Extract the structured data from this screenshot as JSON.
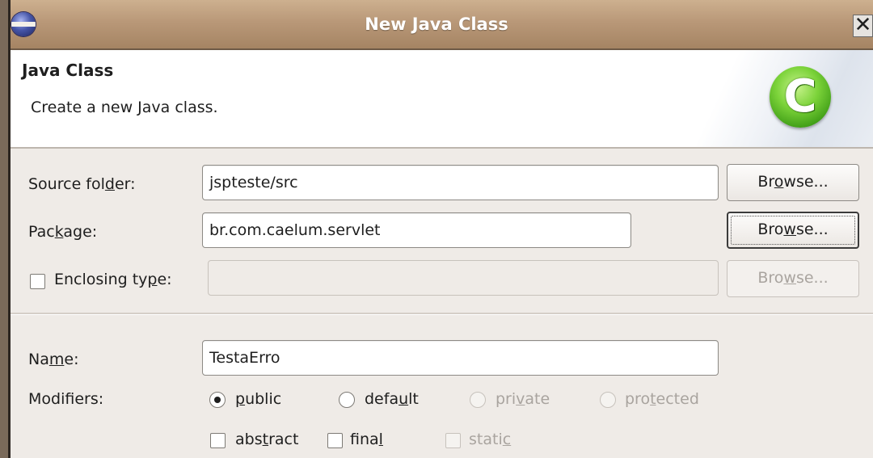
{
  "window": {
    "title": "New Java Class",
    "close_glyph": "✕"
  },
  "header": {
    "title": "Java Class",
    "description": "Create a new Java class.",
    "icon_letter": "C"
  },
  "form": {
    "source_folder": {
      "label_pre": "Source fol",
      "label_mnemonic": "d",
      "label_post": "er:",
      "value": "jspteste/src",
      "browse_pre": "Br",
      "browse_mnemonic": "o",
      "browse_post": "wse..."
    },
    "package": {
      "label_pre": "Pac",
      "label_mnemonic": "k",
      "label_post": "age:",
      "value": "br.com.caelum.servlet",
      "browse_pre": "Bro",
      "browse_mnemonic": "w",
      "browse_post": "se..."
    },
    "enclosing_type": {
      "label_pre": "Enclosing ty",
      "label_mnemonic": "p",
      "label_post": "e:",
      "checked": false,
      "value": "",
      "browse_pre": "Bro",
      "browse_mnemonic": "w",
      "browse_post": "se..."
    },
    "name": {
      "label_pre": "Na",
      "label_mnemonic": "m",
      "label_post": "e:",
      "value": "TestaErro"
    },
    "modifiers": {
      "label": "Modifiers:",
      "options": [
        {
          "pre": "",
          "mnemonic": "p",
          "post": "ublic",
          "selected": true,
          "enabled": true
        },
        {
          "pre": "defa",
          "mnemonic": "u",
          "post": "lt",
          "selected": false,
          "enabled": true
        },
        {
          "pre": "pri",
          "mnemonic": "v",
          "post": "ate",
          "selected": false,
          "enabled": false
        },
        {
          "pre": "pro",
          "mnemonic": "t",
          "post": "ected",
          "selected": false,
          "enabled": false
        }
      ],
      "checks": [
        {
          "pre": "abs",
          "mnemonic": "t",
          "post": "ract",
          "checked": false,
          "enabled": true
        },
        {
          "pre": "fina",
          "mnemonic": "l",
          "post": "",
          "checked": false,
          "enabled": true
        },
        {
          "pre": "stati",
          "mnemonic": "c",
          "post": "",
          "checked": false,
          "enabled": false
        }
      ]
    }
  },
  "colors": {
    "titlebar": "#b99878",
    "icon_green": "#5cbf24",
    "dialog_bg": "#efebe7"
  },
  "icons": [
    "eclipse-app-icon",
    "close-icon",
    "java-class-icon"
  ]
}
